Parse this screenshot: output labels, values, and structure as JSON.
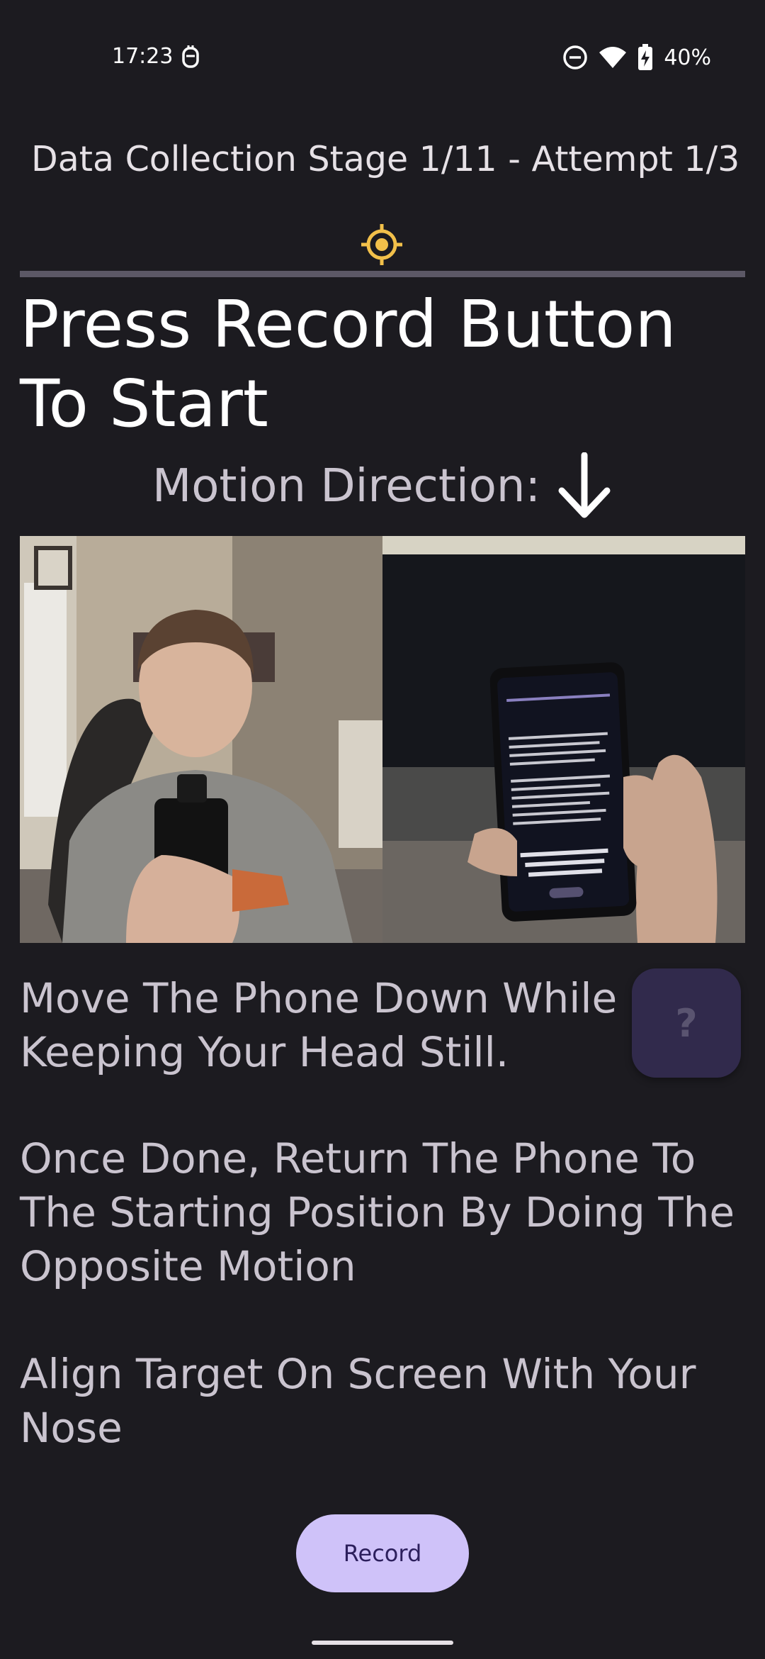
{
  "status_bar": {
    "time": "17:23",
    "battery": "40%",
    "icons": [
      "notification-app-icon",
      "do-not-disturb-icon",
      "wifi-icon",
      "battery-charging-icon"
    ]
  },
  "header": {
    "stage_title": "Data Collection Stage 1/11 - Attempt 1/3",
    "target_icon": "target-icon",
    "progress_fraction": 1.0
  },
  "instruction": {
    "heading": "Press Record Button To Start",
    "motion_label": "Motion Direction:",
    "motion_icon": "arrow-down-icon"
  },
  "examples": {
    "left_image": "person-holding-phone-photo",
    "right_image": "phone-screen-closeup-photo",
    "phone_screen_text": "Move Phone Down - Your nose should be aligned/ pointing to the target on screen"
  },
  "descriptions": {
    "line1": "Move The Phone Down While Keeping Your Head Still.",
    "line2": "Once Done, Return The Phone To The Starting Position By Doing The Opposite Motion",
    "line3": "Align Target On Screen With Your Nose"
  },
  "help_button": {
    "label": "?"
  },
  "record_button": {
    "label": "Record"
  },
  "colors": {
    "background": "#1c1b20",
    "accent_target": "#f2c04a",
    "record_bg": "#cfc2f9",
    "record_text": "#2c1f5c",
    "help_bg": "#312a4c"
  }
}
